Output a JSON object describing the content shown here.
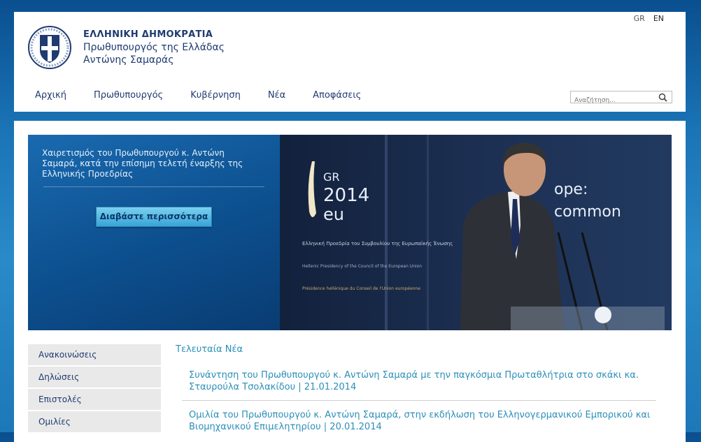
{
  "lang": {
    "gr": "GR",
    "en": "EN"
  },
  "brand": {
    "line1": "ΕΛΛΗΝΙΚΗ ΔΗΜΟΚΡΑΤΙΑ",
    "line2": "Πρωθυπουργός της Ελλάδας",
    "line3": "Αντώνης Σαμαράς"
  },
  "nav": [
    "Αρχική",
    "Πρωθυπουργός",
    "Κυβέρνηση",
    "Νέα",
    "Αποφάσεις"
  ],
  "search": {
    "placeholder": "Αναζήτηση..."
  },
  "hero": {
    "caption": "Χαιρετισμός του Πρωθυπουργού κ. Αντώνη Σαμαρά, κατά την επίσημη τελετή έναρξης της Ελληνικής Προεδρίας",
    "button": "Διαβάστε περισσότερα",
    "banner": {
      "gr": "GR",
      "year": "2014",
      "eu": "eu",
      "text1": "Ελληνική Προεδρία του Συμβουλίου της Ευρωπαϊκής Ένωσης",
      "text2": "Hellenic Presidency of the Council of the European Union",
      "text3": "Présidence hellénique du Conseil de l'Union européenne",
      "slogan1": "ope:",
      "slogan2": "common"
    }
  },
  "sidebar": [
    "Ανακοινώσεις",
    "Δηλώσεις",
    "Επιστολές",
    "Ομιλίες"
  ],
  "news": {
    "title": "Τελευταία Νέα",
    "items": [
      "Συνάντηση του Πρωθυπουργού κ. Αντώνη Σαμαρά με την παγκόσμια Πρωταθλήτρια στο σκάκι κα. Σταυρούλα Τσολακίδου | 21.01.2014",
      "Ομιλία του Πρωθυπουργού κ. Αντώνη Σαμαρά, στην εκδήλωση του Ελληνογερμανικού Εμπορικού και Βιομηχανικού Επιμελητηρίου | 20.01.2014"
    ]
  },
  "colors": {
    "brand": "#1f3b70",
    "link": "#2a8fb8",
    "hero_bg": "#0c4f8e",
    "button": "#38a4d8"
  }
}
